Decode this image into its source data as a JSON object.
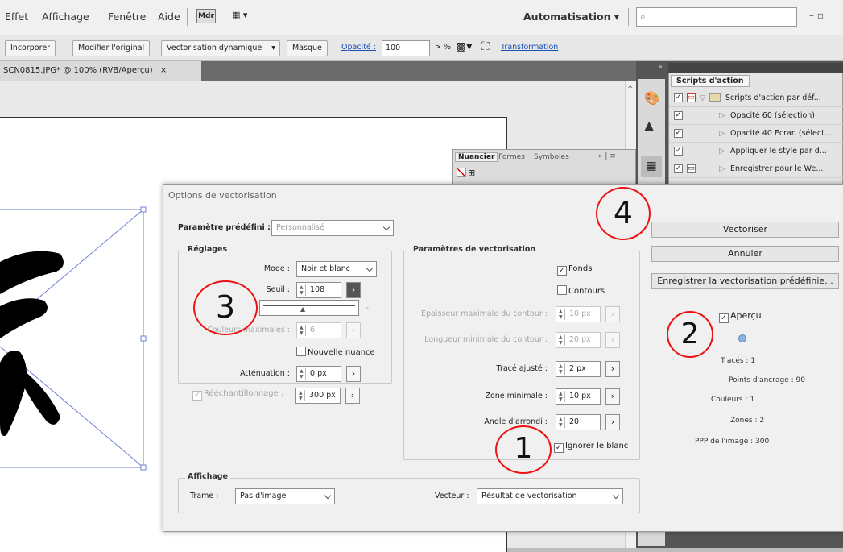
{
  "menu": {
    "items": [
      "Effet",
      "Affichage",
      "Fenêtre",
      "Aide"
    ],
    "bridge": "Mdr",
    "workspace": "Automatisation",
    "window_controls": "–  ▫"
  },
  "control_bar": {
    "embed": "Incorporer",
    "edit_original": "Modifier l'original",
    "live_trace": "Vectorisation dynamique",
    "mask": "Masque",
    "opacity_label": "Opacité :",
    "opacity_value": "100",
    "opacity_unit": "> %",
    "transform": "Transformation"
  },
  "document_tab": {
    "title": "SCN0815.JPG* @ 100% (RVB/Aperçu)",
    "close": "×"
  },
  "actions_panel": {
    "title": "Scripts d'action",
    "rows": [
      {
        "label": "Scripts d'action par déf..."
      },
      {
        "label": "Opacité 60 (sélection)"
      },
      {
        "label": "Opacité 40 Ecran (sélect..."
      },
      {
        "label": "Appliquer le style par d..."
      },
      {
        "label": "Enregistrer pour le We..."
      }
    ]
  },
  "swatch_panel": {
    "tabs": [
      "Nuancier",
      "Formes",
      "Symboles"
    ]
  },
  "dialog": {
    "title": "Options de vectorisation",
    "preset_label": "Paramètre prédéfini :",
    "preset_value": "Personnalisé",
    "settings": {
      "title": "Réglages",
      "mode_label": "Mode :",
      "mode_value": "Noir et blanc",
      "threshold_label": "Seuil :",
      "threshold_value": "108",
      "max_colors_label": "Couleurs maximales :",
      "max_colors_value": "6",
      "new_swatch": "Nouvelle nuance",
      "blur_label": "Atténuation :",
      "blur_value": "0 px",
      "resample_label": "Rééchantillonnage :",
      "resample_value": "300 px"
    },
    "trace": {
      "title": "Paramètres de vectorisation",
      "fills": "Fonds",
      "strokes": "Contours",
      "max_stroke_label": "Epaisseur maximale du contour :",
      "max_stroke_value": "10 px",
      "min_stroke_label": "Longueur minimale du contour :",
      "min_stroke_value": "20 px",
      "path_fitting_label": "Tracé ajusté :",
      "path_fitting_value": "2 px",
      "min_area_label": "Zone minimale :",
      "min_area_value": "10 px",
      "corner_angle_label": "Angle d'arrondi :",
      "corner_angle_value": "20",
      "ignore_white": "Ignorer le blanc"
    },
    "view": {
      "title": "Affichage",
      "raster_label": "Trame :",
      "raster_value": "Pas d'image",
      "vector_label": "Vecteur :",
      "vector_value": "Résultat de vectorisation"
    },
    "buttons": {
      "trace": "Vectoriser",
      "cancel": "Annuler",
      "save_preset": "Enregistrer la vectorisation prédéfinie..."
    },
    "preview": "Aperçu",
    "stats": {
      "paths": "Tracés : 1",
      "anchors": "Points d'ancrage : 90",
      "colors": "Couleurs : 1",
      "areas": "Zones : 2",
      "ppi": "PPP de l'image : 300"
    }
  },
  "annotations": [
    "1",
    "2",
    "3",
    "4"
  ],
  "colors": {
    "annotation": "#e11111",
    "link": "#1a4fb5",
    "dialog_bg": "#f0f0f0"
  }
}
